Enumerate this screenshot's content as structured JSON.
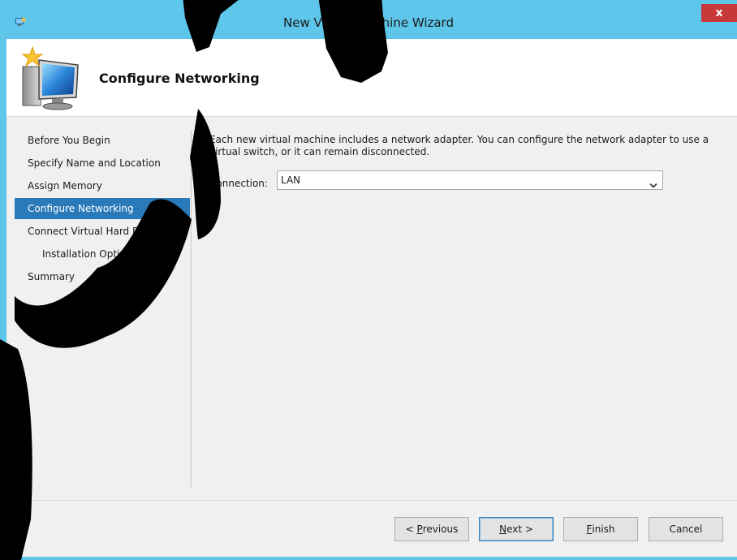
{
  "window": {
    "title": "New Virtual Machine Wizard",
    "close_label": "x",
    "app_icon": "virtual-machine-icon",
    "accent_color": "#5ec6ea"
  },
  "header": {
    "title": "Configure Networking",
    "icon": "new-virtual-machine-icon"
  },
  "nav": {
    "items": [
      {
        "label": "Before You Begin",
        "selected": false,
        "indent": false
      },
      {
        "label": "Specify Name and Location",
        "selected": false,
        "indent": false
      },
      {
        "label": "Assign Memory",
        "selected": false,
        "indent": false
      },
      {
        "label": "Configure Networking",
        "selected": true,
        "indent": false
      },
      {
        "label": "Connect Virtual Hard Disk",
        "selected": false,
        "indent": false
      },
      {
        "label": "Installation Options",
        "selected": false,
        "indent": true
      },
      {
        "label": "Summary",
        "selected": false,
        "indent": false
      }
    ],
    "selected_color": "#2a79b8"
  },
  "main": {
    "description": "Each new virtual machine includes a network adapter. You can configure the network adapter to use a virtual switch, or it can remain disconnected.",
    "connection": {
      "label_mnemonic": "C",
      "label_rest": "onnection:",
      "value": "LAN"
    }
  },
  "buttons": {
    "previous": {
      "prefix": "< ",
      "mnemonic": "P",
      "rest": "revious"
    },
    "next": {
      "prefix": "",
      "mnemonic": "N",
      "rest": "ext >"
    },
    "finish": {
      "prefix": "",
      "mnemonic": "F",
      "rest": "inish"
    },
    "cancel": {
      "label": "Cancel"
    }
  }
}
